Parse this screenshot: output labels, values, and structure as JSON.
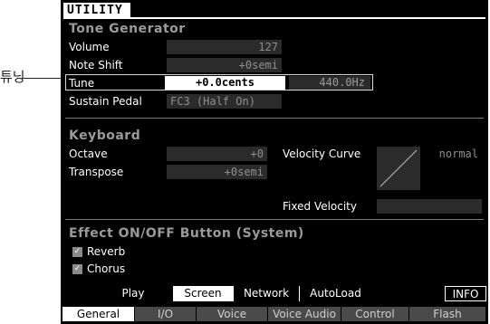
{
  "callout": {
    "label": "튜닝"
  },
  "title": "UTILITY",
  "tone_generator": {
    "heading": "Tone Generator",
    "volume": {
      "label": "Volume",
      "value": "127"
    },
    "note_shift": {
      "label": "Note Shift",
      "value": "+0semi"
    },
    "tune": {
      "label": "Tune",
      "cents": "+0.0cents",
      "hz": "440.0Hz"
    },
    "sustain_pedal": {
      "label": "Sustain Pedal",
      "value": "FC3 (Half On)"
    }
  },
  "keyboard": {
    "heading": "Keyboard",
    "octave": {
      "label": "Octave",
      "value": "+0"
    },
    "transpose": {
      "label": "Transpose",
      "value": "+0semi"
    },
    "velocity_curve": {
      "label": "Velocity Curve",
      "value": "normal"
    },
    "fixed_velocity": {
      "label": "Fixed Velocity",
      "value": ""
    }
  },
  "effect_switch": {
    "heading": "Effect ON/OFF Button (System)",
    "reverb": {
      "label": "Reverb",
      "checked": true
    },
    "chorus": {
      "label": "Chorus",
      "checked": true
    }
  },
  "upper_tabs": [
    "Play",
    "Screen",
    "Network",
    "AutoLoad"
  ],
  "info_button": "INFO",
  "bottom_tabs": [
    "General",
    "I/O",
    "Voice",
    "Voice Audio",
    "Control",
    "Flash"
  ],
  "colors": {
    "screen_bg": "#000000",
    "field_bg": "#2b2b2b",
    "heading_gray": "#9a9a9a",
    "highlight": "#ffffff"
  }
}
